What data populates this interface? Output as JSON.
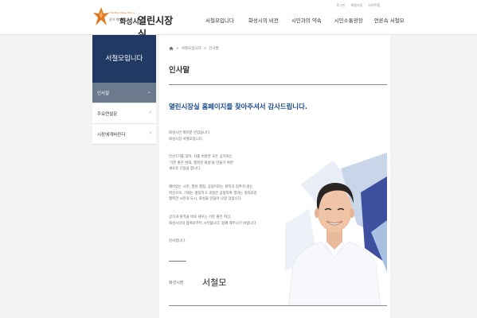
{
  "header": {
    "logo_tag": "The Boundless Future",
    "logo_small": "같이 열어가는",
    "logo_city": "화성시",
    "logo_title": "열린시장실",
    "utils": [
      "로그인",
      "회원가입",
      "사이트맵"
    ],
    "nav": [
      "서철모입니다",
      "화성시의 비전",
      "시민과의 약속",
      "시민소통광장",
      "언론속 서철모"
    ]
  },
  "sidebar": {
    "title": "서철모입니다",
    "items": [
      {
        "label": "인사말",
        "active": true
      },
      {
        "label": "주요연설문",
        "active": false
      },
      {
        "label": "시장에게바란다",
        "active": false
      }
    ]
  },
  "breadcrumb": {
    "items": [
      "서철모입니다",
      "인사말"
    ],
    "separator": ">"
  },
  "main": {
    "title": "인사말",
    "headline": "열린시장실 홈페이지를 찾아주셔서 감사드립니다.",
    "paragraphs": [
      [
        "화성시민 여러분 반갑습니다.",
        "화성시장 서철모입니다."
      ],
      [
        "민선7기를 맞아, 자를 비롯한 모든 공직자는",
        "'기본 좋은 변화, 행복한 화성'을 만들기 위한",
        "새로운 다짐을 합니다."
      ],
      [
        "깨어있는 시민, 열린 행정, 공정이라는 원칙과 멈추지 않는",
        "혁신으로, 기회는 평등하고 과정은 공정하며 결과는 정의로운",
        "행복한 시민의 도시, 화성을 만들어 나갈 것입니다."
      ],
      [
        "상식과 원칙을 바로 세우는 기본 좋은 혁신,",
        "화성시민의 참여로부터 시작됩니다. 함께 해주시기 바랍니다."
      ],
      [
        "감사합니다."
      ]
    ],
    "signature_position": "화성시장",
    "signature_name": "서철모"
  },
  "colors": {
    "brand_navy": "#203a64",
    "headline_blue": "#1f4e8c",
    "active_menu": "#6b7a8c",
    "logo_orange": "#e07a20"
  }
}
